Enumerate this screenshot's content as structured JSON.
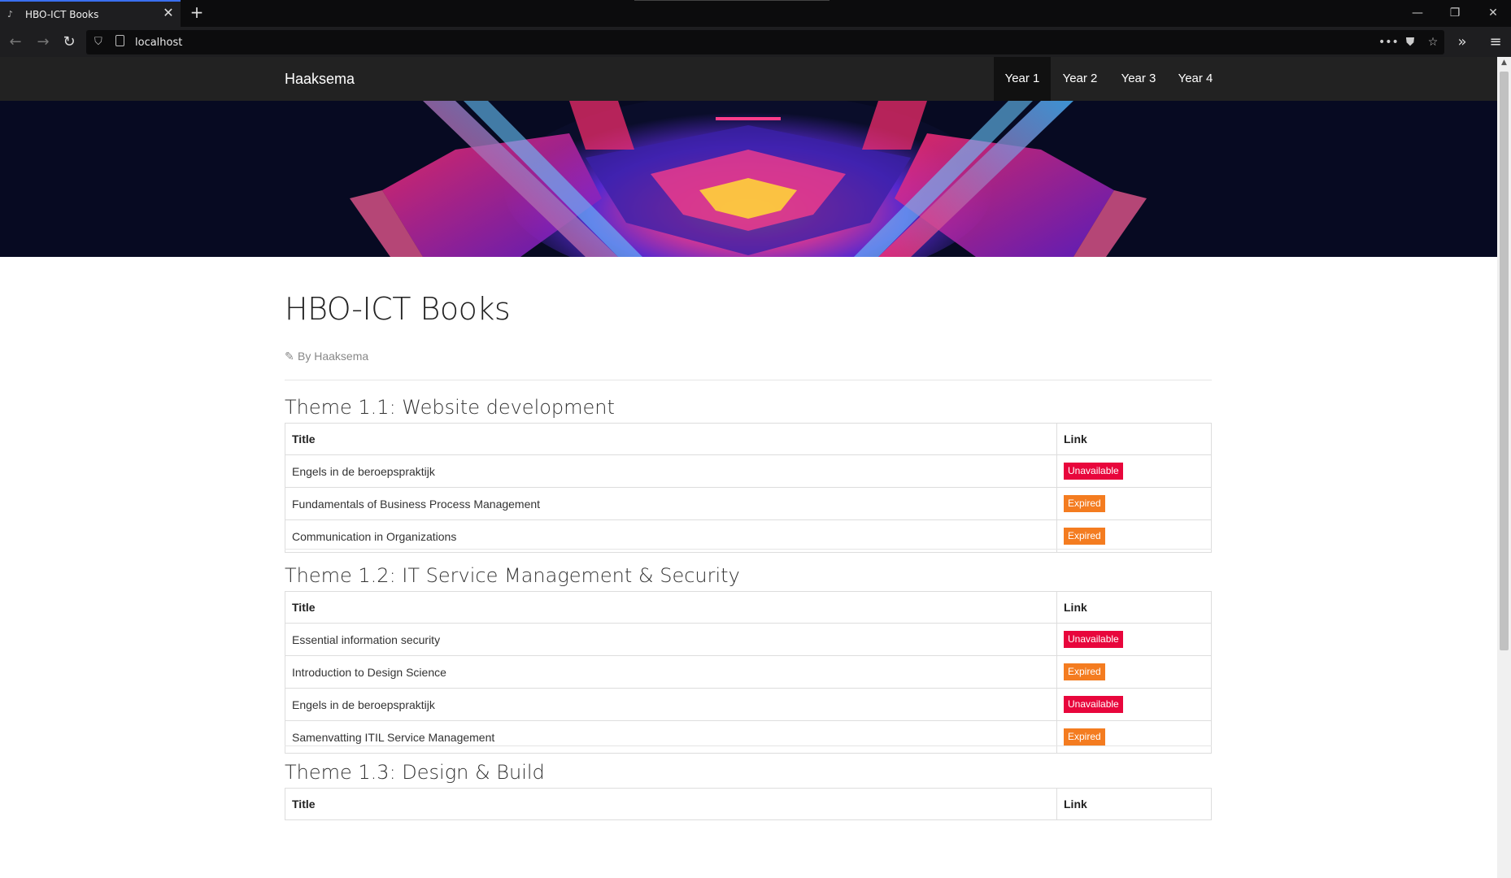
{
  "browser": {
    "tab_title": "HBO-ICT Books",
    "url": "localhost"
  },
  "site": {
    "brand": "Haaksema",
    "nav": [
      {
        "label": "Year 1",
        "active": true
      },
      {
        "label": "Year 2",
        "active": false
      },
      {
        "label": "Year 3",
        "active": false
      },
      {
        "label": "Year 4",
        "active": false
      }
    ]
  },
  "page": {
    "title": "HBO-ICT Books",
    "byline": "By Haaksema",
    "col_title": "Title",
    "col_link": "Link",
    "themes": [
      {
        "title": "Theme 1.1: Website development",
        "books": [
          {
            "title": "Engels in de beroepspraktijk",
            "status": "Unavailable"
          },
          {
            "title": "Fundamentals of Business Process Management",
            "status": "Expired"
          },
          {
            "title": "Communication in Organizations",
            "status": "Expired"
          }
        ]
      },
      {
        "title": "Theme 1.2: IT Service Management & Security",
        "books": [
          {
            "title": "Essential information security",
            "status": "Unavailable"
          },
          {
            "title": "Introduction to Design Science",
            "status": "Expired"
          },
          {
            "title": "Engels in de beroepspraktijk",
            "status": "Unavailable"
          },
          {
            "title": "Samenvatting ITIL Service Management",
            "status": "Expired"
          }
        ]
      },
      {
        "title": "Theme 1.3: Design & Build",
        "books": []
      }
    ]
  },
  "colors": {
    "unavailable": "#e8063c",
    "expired": "#f47c20",
    "navbar": "#222222"
  }
}
